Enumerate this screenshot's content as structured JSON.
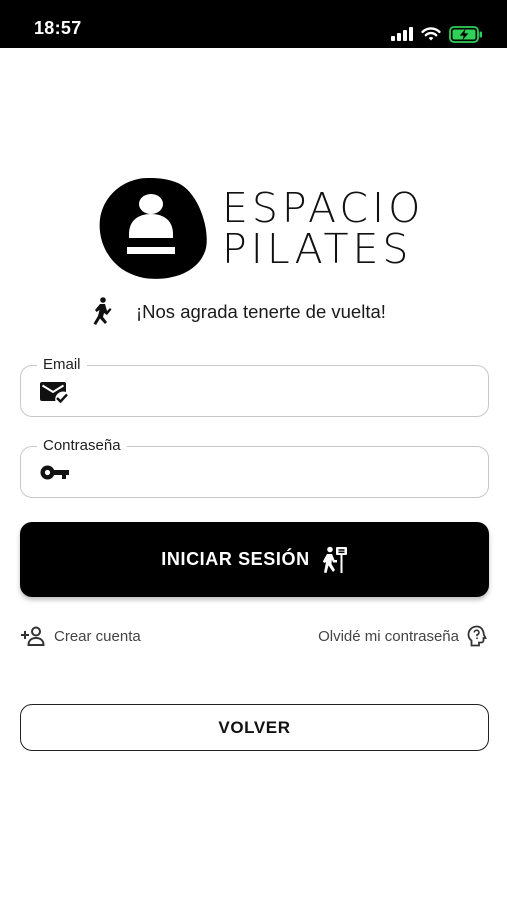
{
  "status_bar": {
    "time": "18:57",
    "icons": [
      "signal-icon",
      "wifi-icon",
      "battery-charging-icon"
    ],
    "battery_color": "#30d158"
  },
  "brand": {
    "line1": "ESPACIO",
    "line2": "PILATES"
  },
  "welcome": {
    "icon": "figure-dance-icon",
    "text": "¡Nos agrada tenerte de vuelta!"
  },
  "form": {
    "email": {
      "label": "Email",
      "value": "",
      "icon": "mail-check-icon"
    },
    "password": {
      "label": "Contraseña",
      "value": "",
      "icon": "key-icon"
    }
  },
  "actions": {
    "login_label": "INICIAR SESIÓN",
    "login_icon": "hiking-sign-icon",
    "create_account_label": "Crear cuenta",
    "create_account_icon": "person-add-icon",
    "forgot_password_label": "Olvidé mi contraseña",
    "forgot_password_icon": "psychology-question-icon",
    "back_label": "VOLVER"
  },
  "colors": {
    "primary": "#000000",
    "background": "#ffffff",
    "field_border": "#c8c8c8"
  }
}
